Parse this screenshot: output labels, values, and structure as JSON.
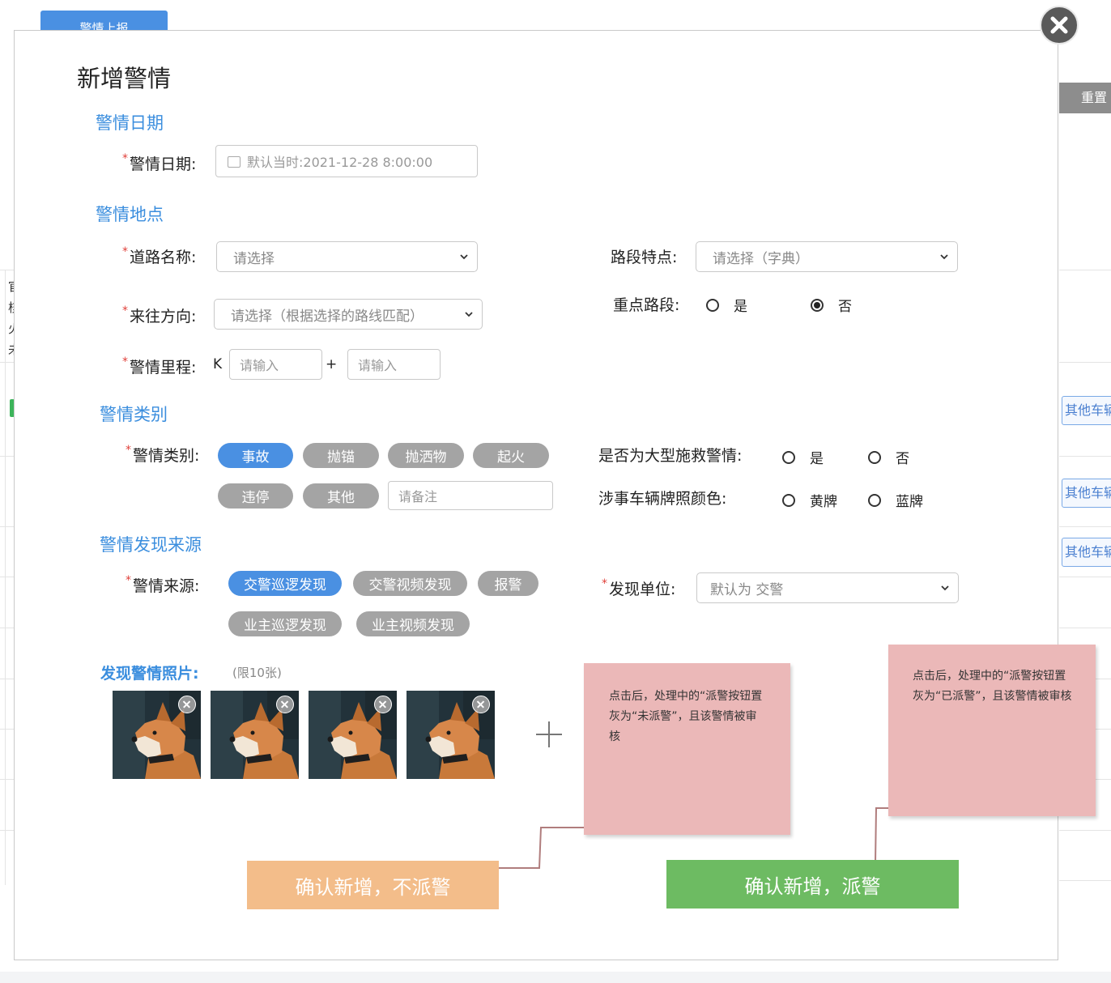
{
  "background": {
    "top_button_label": "警情上报",
    "reset_label": "重置",
    "other_vehicle_buttons": [
      "其他车辆",
      "其他车辆",
      "其他车辆"
    ],
    "left_cut_chars": [
      "官",
      "核",
      "火",
      "未"
    ]
  },
  "modal": {
    "title": "新增警情",
    "sections": {
      "date": "警情日期",
      "location": "警情地点",
      "category": "警情类别",
      "source": "警情发现来源"
    },
    "date_field": {
      "label": "警情日期:",
      "placeholder": "默认当时:2021-12-28 8:00:00"
    },
    "road_name": {
      "label": "道路名称:",
      "placeholder": "请选择"
    },
    "direction": {
      "label": "来往方向:",
      "placeholder": "请选择（根据选择的路线匹配）"
    },
    "mileage": {
      "label": "警情里程:",
      "prefix": "K",
      "input1_placeholder": "请输入",
      "plus": "+",
      "input2_placeholder": "请输入"
    },
    "segment_feature": {
      "label": "路段特点:",
      "placeholder": "请选择（字典）"
    },
    "key_segment": {
      "label": "重点路段:",
      "options": [
        "是",
        "否"
      ],
      "selected": "否"
    },
    "category_field": {
      "label": "警情类别:",
      "options": [
        "事故",
        "抛锚",
        "抛洒物",
        "起火",
        "违停",
        "其他"
      ],
      "selected": "事故",
      "remark_placeholder": "请备注"
    },
    "large_rescue": {
      "label": "是否为大型施救警情:",
      "options": [
        "是",
        "否"
      ]
    },
    "plate_color": {
      "label": "涉事车辆牌照颜色:",
      "options": [
        "黄牌",
        "蓝牌"
      ]
    },
    "source_field": {
      "label": "警情来源:",
      "options": [
        "交警巡逻发现",
        "交警视频发现",
        "报警",
        "业主巡逻发现",
        "业主视频发现"
      ],
      "selected": "交警巡逻发现"
    },
    "discover_unit": {
      "label": "发现单位:",
      "placeholder": "默认为 交警"
    },
    "photos": {
      "label": "发现警情照片:",
      "limit": "(限10张)",
      "count": 4,
      "add_symbol": "+"
    },
    "buttons": {
      "confirm_no_dispatch": "确认新增，不派警",
      "confirm_dispatch": "确认新增，派警"
    }
  },
  "annotations": {
    "note_no_dispatch": "点击后，处理中的“派警按钮置灰为“未派警”，且该警情被审核",
    "note_dispatch": "点击后，处理中的“派警按钮置灰为“已派警”，且该警情被审核"
  },
  "colors": {
    "accent_blue": "#4a90e2",
    "section_blue": "#3b8ede",
    "pill_gray": "#a4a4a4",
    "btn_orange": "#f3bd8a",
    "btn_green": "#6dbb62",
    "note_pink": "#ebb8b8",
    "required_red": "#e0403a"
  }
}
